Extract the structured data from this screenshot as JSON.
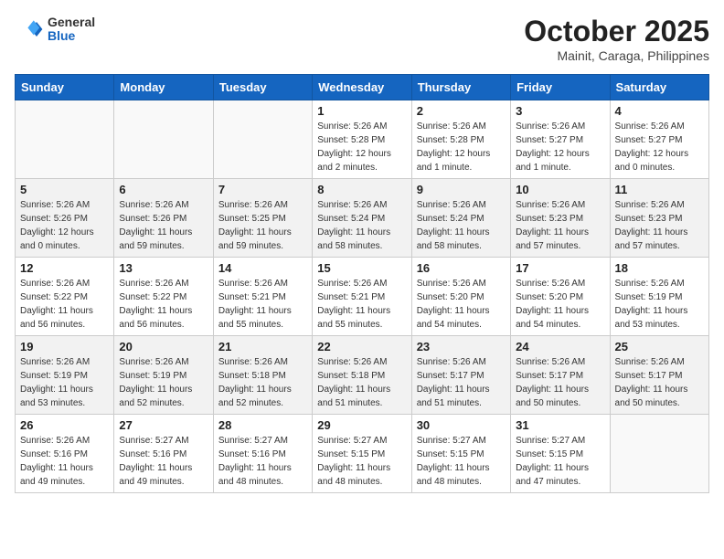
{
  "header": {
    "logo_general": "General",
    "logo_blue": "Blue",
    "month_title": "October 2025",
    "location": "Mainit, Caraga, Philippines"
  },
  "calendar": {
    "days_of_week": [
      "Sunday",
      "Monday",
      "Tuesday",
      "Wednesday",
      "Thursday",
      "Friday",
      "Saturday"
    ],
    "weeks": [
      [
        {
          "day": "",
          "info": ""
        },
        {
          "day": "",
          "info": ""
        },
        {
          "day": "",
          "info": ""
        },
        {
          "day": "1",
          "info": "Sunrise: 5:26 AM\nSunset: 5:28 PM\nDaylight: 12 hours\nand 2 minutes."
        },
        {
          "day": "2",
          "info": "Sunrise: 5:26 AM\nSunset: 5:28 PM\nDaylight: 12 hours\nand 1 minute."
        },
        {
          "day": "3",
          "info": "Sunrise: 5:26 AM\nSunset: 5:27 PM\nDaylight: 12 hours\nand 1 minute."
        },
        {
          "day": "4",
          "info": "Sunrise: 5:26 AM\nSunset: 5:27 PM\nDaylight: 12 hours\nand 0 minutes."
        }
      ],
      [
        {
          "day": "5",
          "info": "Sunrise: 5:26 AM\nSunset: 5:26 PM\nDaylight: 12 hours\nand 0 minutes."
        },
        {
          "day": "6",
          "info": "Sunrise: 5:26 AM\nSunset: 5:26 PM\nDaylight: 11 hours\nand 59 minutes."
        },
        {
          "day": "7",
          "info": "Sunrise: 5:26 AM\nSunset: 5:25 PM\nDaylight: 11 hours\nand 59 minutes."
        },
        {
          "day": "8",
          "info": "Sunrise: 5:26 AM\nSunset: 5:24 PM\nDaylight: 11 hours\nand 58 minutes."
        },
        {
          "day": "9",
          "info": "Sunrise: 5:26 AM\nSunset: 5:24 PM\nDaylight: 11 hours\nand 58 minutes."
        },
        {
          "day": "10",
          "info": "Sunrise: 5:26 AM\nSunset: 5:23 PM\nDaylight: 11 hours\nand 57 minutes."
        },
        {
          "day": "11",
          "info": "Sunrise: 5:26 AM\nSunset: 5:23 PM\nDaylight: 11 hours\nand 57 minutes."
        }
      ],
      [
        {
          "day": "12",
          "info": "Sunrise: 5:26 AM\nSunset: 5:22 PM\nDaylight: 11 hours\nand 56 minutes."
        },
        {
          "day": "13",
          "info": "Sunrise: 5:26 AM\nSunset: 5:22 PM\nDaylight: 11 hours\nand 56 minutes."
        },
        {
          "day": "14",
          "info": "Sunrise: 5:26 AM\nSunset: 5:21 PM\nDaylight: 11 hours\nand 55 minutes."
        },
        {
          "day": "15",
          "info": "Sunrise: 5:26 AM\nSunset: 5:21 PM\nDaylight: 11 hours\nand 55 minutes."
        },
        {
          "day": "16",
          "info": "Sunrise: 5:26 AM\nSunset: 5:20 PM\nDaylight: 11 hours\nand 54 minutes."
        },
        {
          "day": "17",
          "info": "Sunrise: 5:26 AM\nSunset: 5:20 PM\nDaylight: 11 hours\nand 54 minutes."
        },
        {
          "day": "18",
          "info": "Sunrise: 5:26 AM\nSunset: 5:19 PM\nDaylight: 11 hours\nand 53 minutes."
        }
      ],
      [
        {
          "day": "19",
          "info": "Sunrise: 5:26 AM\nSunset: 5:19 PM\nDaylight: 11 hours\nand 53 minutes."
        },
        {
          "day": "20",
          "info": "Sunrise: 5:26 AM\nSunset: 5:19 PM\nDaylight: 11 hours\nand 52 minutes."
        },
        {
          "day": "21",
          "info": "Sunrise: 5:26 AM\nSunset: 5:18 PM\nDaylight: 11 hours\nand 52 minutes."
        },
        {
          "day": "22",
          "info": "Sunrise: 5:26 AM\nSunset: 5:18 PM\nDaylight: 11 hours\nand 51 minutes."
        },
        {
          "day": "23",
          "info": "Sunrise: 5:26 AM\nSunset: 5:17 PM\nDaylight: 11 hours\nand 51 minutes."
        },
        {
          "day": "24",
          "info": "Sunrise: 5:26 AM\nSunset: 5:17 PM\nDaylight: 11 hours\nand 50 minutes."
        },
        {
          "day": "25",
          "info": "Sunrise: 5:26 AM\nSunset: 5:17 PM\nDaylight: 11 hours\nand 50 minutes."
        }
      ],
      [
        {
          "day": "26",
          "info": "Sunrise: 5:26 AM\nSunset: 5:16 PM\nDaylight: 11 hours\nand 49 minutes."
        },
        {
          "day": "27",
          "info": "Sunrise: 5:27 AM\nSunset: 5:16 PM\nDaylight: 11 hours\nand 49 minutes."
        },
        {
          "day": "28",
          "info": "Sunrise: 5:27 AM\nSunset: 5:16 PM\nDaylight: 11 hours\nand 48 minutes."
        },
        {
          "day": "29",
          "info": "Sunrise: 5:27 AM\nSunset: 5:15 PM\nDaylight: 11 hours\nand 48 minutes."
        },
        {
          "day": "30",
          "info": "Sunrise: 5:27 AM\nSunset: 5:15 PM\nDaylight: 11 hours\nand 48 minutes."
        },
        {
          "day": "31",
          "info": "Sunrise: 5:27 AM\nSunset: 5:15 PM\nDaylight: 11 hours\nand 47 minutes."
        },
        {
          "day": "",
          "info": ""
        }
      ]
    ]
  }
}
